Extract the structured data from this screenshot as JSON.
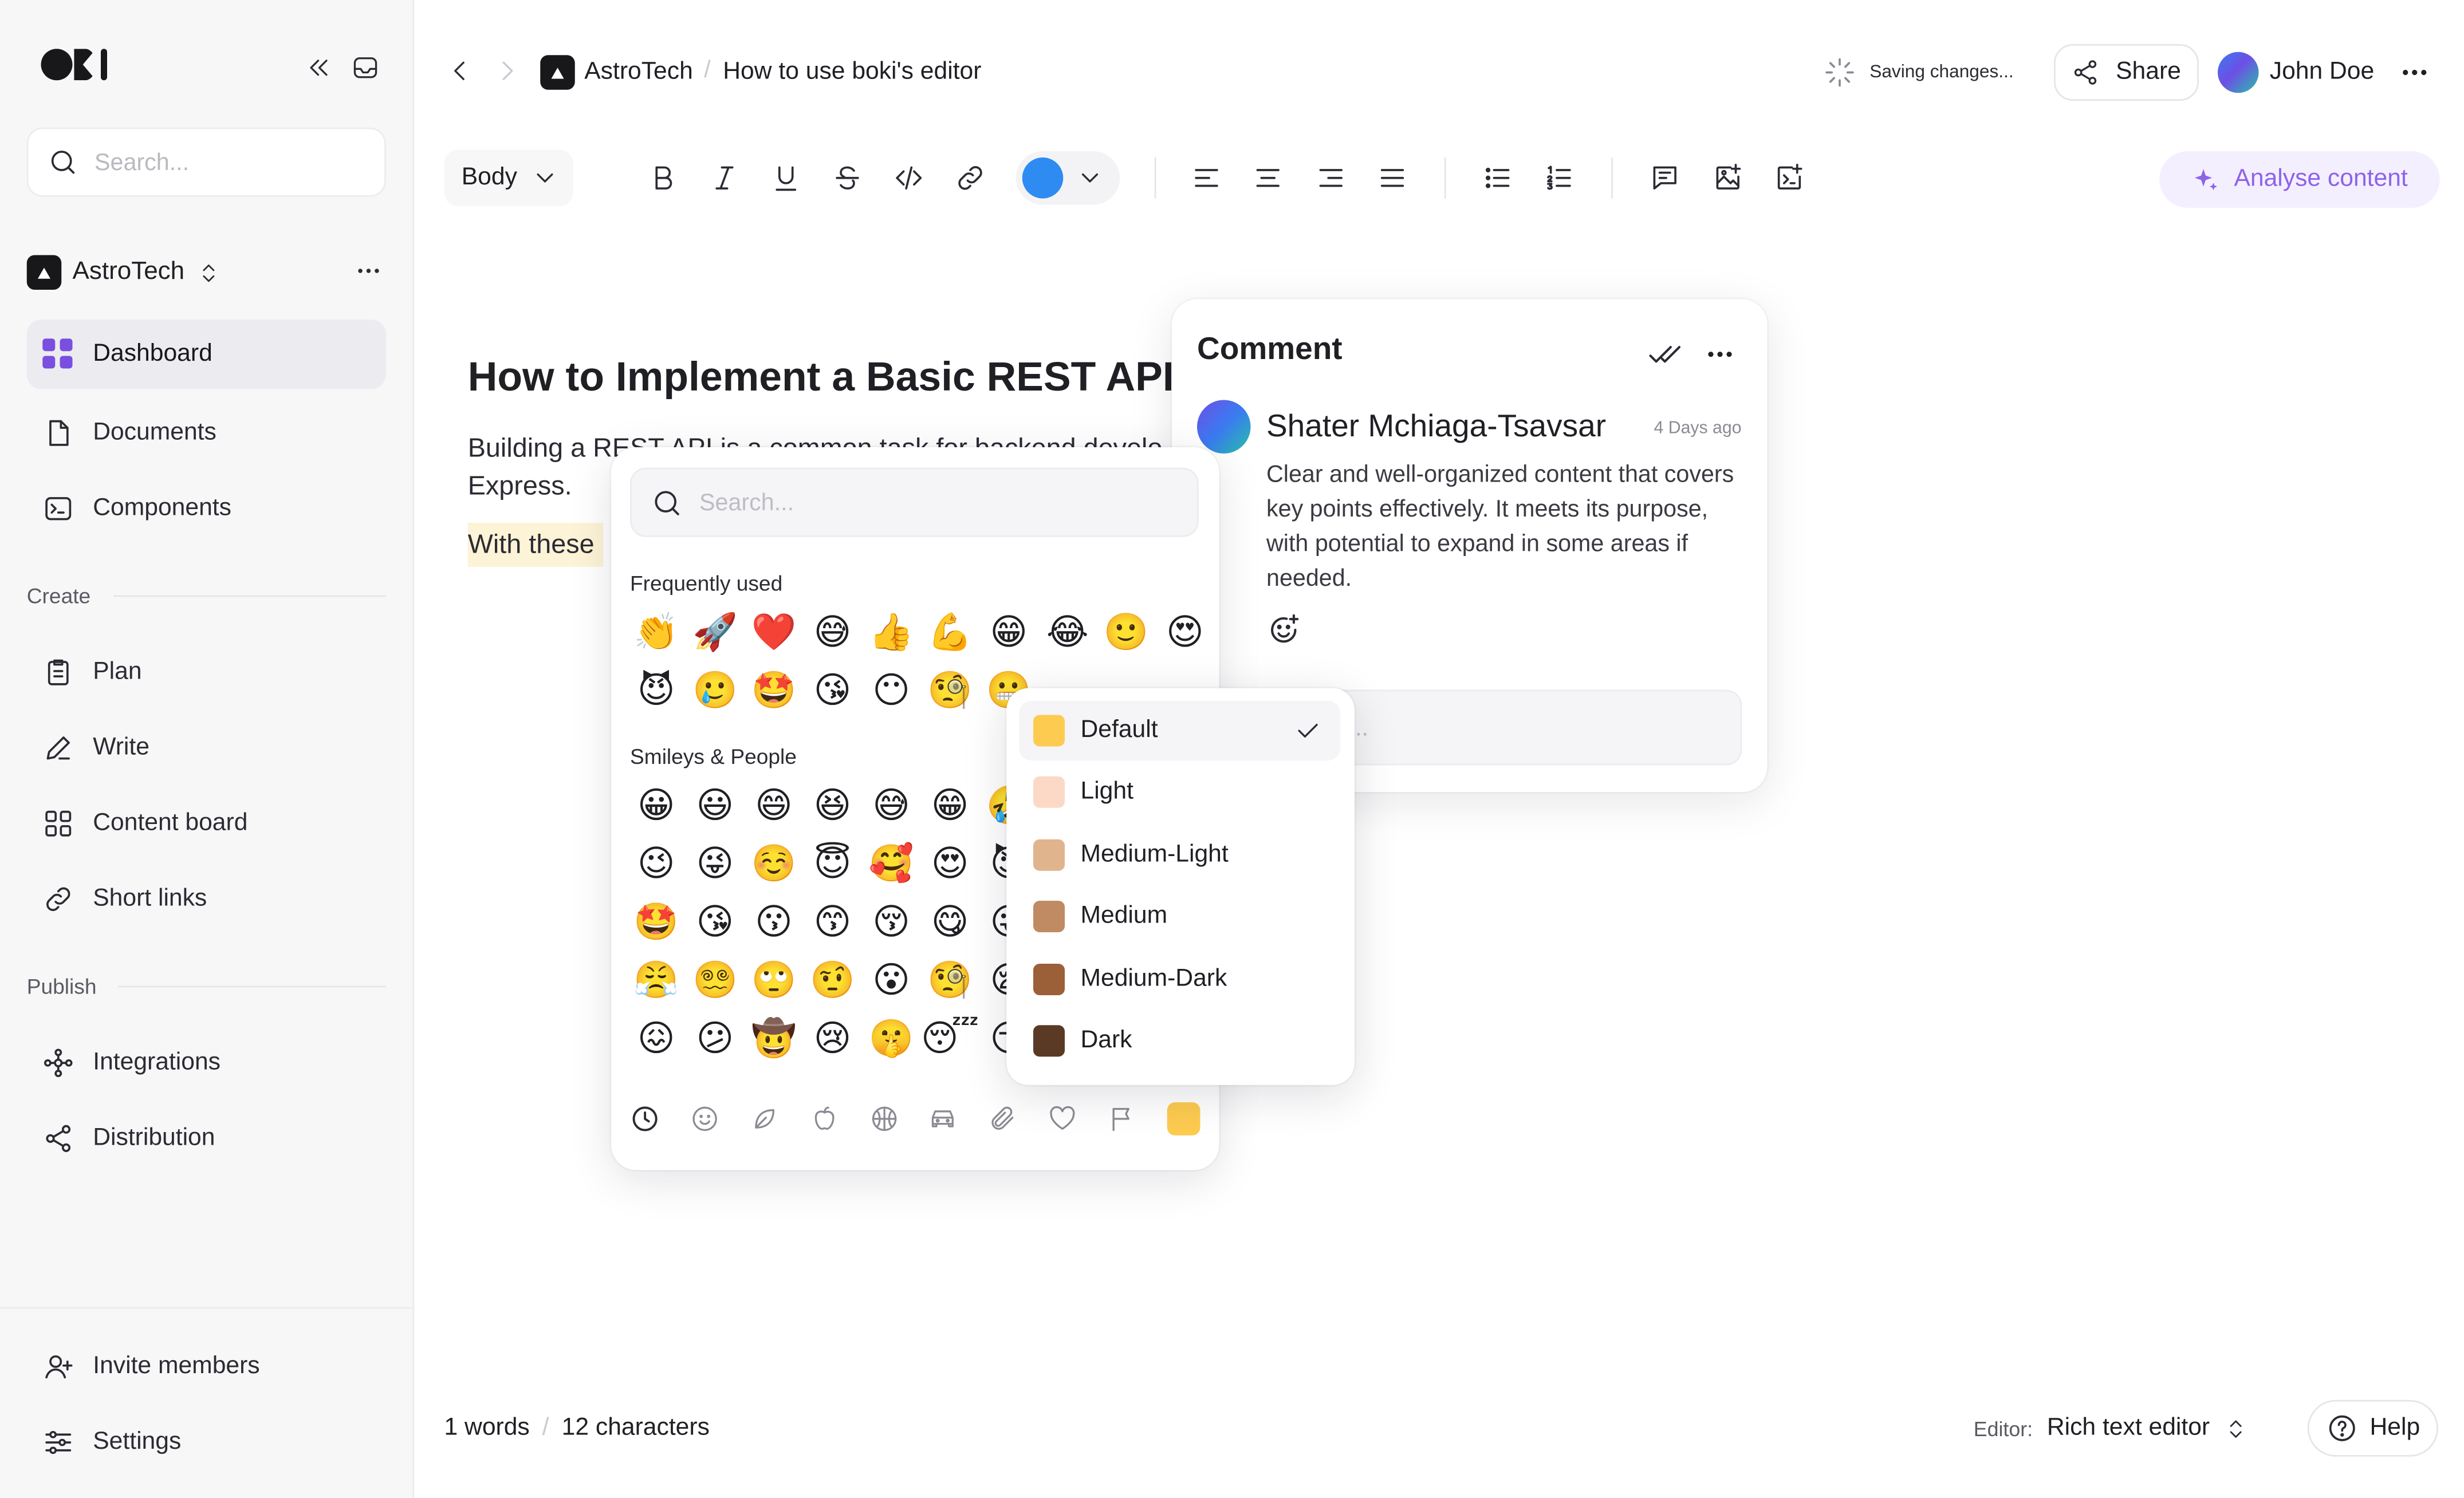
{
  "sidebar": {
    "search_placeholder": "Search...",
    "workspace": "AstroTech",
    "nav": [
      {
        "label": "Dashboard",
        "icon": "dashboard-icon"
      },
      {
        "label": "Documents",
        "icon": "document-icon"
      },
      {
        "label": "Components",
        "icon": "terminal-icon"
      }
    ],
    "create_section": "Create",
    "create_items": [
      {
        "label": "Plan",
        "icon": "clipboard-icon"
      },
      {
        "label": "Write",
        "icon": "pen-icon"
      },
      {
        "label": "Content board",
        "icon": "board-icon"
      },
      {
        "label": "Short links",
        "icon": "link-icon"
      }
    ],
    "publish_section": "Publish",
    "publish_items": [
      {
        "label": "Integrations",
        "icon": "integrations-icon"
      },
      {
        "label": "Distribution",
        "icon": "share-icon"
      }
    ],
    "bottom_items": [
      {
        "label": "Invite members",
        "icon": "user-plus-icon"
      },
      {
        "label": "Settings",
        "icon": "settings-icon"
      }
    ]
  },
  "topbar": {
    "breadcrumb_workspace": "AstroTech",
    "breadcrumb_doc": "How to use boki's editor",
    "saving": "Saving changes...",
    "share_label": "Share",
    "user_name": "John Doe"
  },
  "toolbar": {
    "block_type": "Body",
    "text_color": "#2e8bf2",
    "analyse_label": "Analyse content"
  },
  "document": {
    "title": "How to Implement a Basic REST API",
    "paragraph1": "Building a REST API is a common task for backend develo",
    "paragraph1_cont": "Express.",
    "paragraph2": "With these"
  },
  "emoji_picker": {
    "search_placeholder": "Search...",
    "frequent_label": "Frequently used",
    "frequent": [
      "👏",
      "🚀",
      "❤️",
      "😅",
      "👍",
      "💪",
      "😁",
      "😂",
      "🙂",
      "😍",
      "😈",
      "🥲",
      "🤩",
      "😘",
      "😶",
      "🧐",
      "😬"
    ],
    "smileys_label": "Smileys & People",
    "smileys": [
      [
        "😀",
        "😃",
        "😄",
        "😆",
        "😅",
        "😁",
        "🤣"
      ],
      [
        "😉",
        "😜",
        "☺️",
        "😇",
        "🥰",
        "😍",
        "😈"
      ],
      [
        "🤩",
        "😘",
        "😗",
        "😙",
        "😚",
        "😋",
        "😛"
      ],
      [
        "😤",
        "😵‍💫",
        "🙄",
        "🤨",
        "😮",
        "🧐",
        "😪"
      ],
      [
        "😖",
        "😕",
        "🤠",
        "😢",
        "🤫",
        "😴",
        "😏"
      ]
    ],
    "categories": [
      "clock-icon",
      "smile-icon",
      "leaf-icon",
      "apple-icon",
      "ball-icon",
      "car-icon",
      "paperclip-icon",
      "heart-icon",
      "flag-icon"
    ],
    "selected_tone_color": "#fdcb4f"
  },
  "skin_tones": [
    {
      "label": "Default",
      "color": "#fdcb4f",
      "selected": true
    },
    {
      "label": "Light",
      "color": "#fcd9c6"
    },
    {
      "label": "Medium-Light",
      "color": "#e0b48c"
    },
    {
      "label": "Medium",
      "color": "#c08b62"
    },
    {
      "label": "Medium-Dark",
      "color": "#9b6037"
    },
    {
      "label": "Dark",
      "color": "#5a3a25"
    }
  ],
  "comment": {
    "title": "Comment",
    "author": "Shater Mchiaga-Tsavsar",
    "time": "4 Days ago",
    "text": "Clear and well-organized content that covers key points effectively. It meets its purpose, with potential to expand in some areas if needed.",
    "reply_placeholder": "Reply..."
  },
  "footer": {
    "words": "1 words",
    "characters": "12 characters",
    "editor_label": "Editor:",
    "editor_value": "Rich text editor",
    "help_label": "Help"
  }
}
